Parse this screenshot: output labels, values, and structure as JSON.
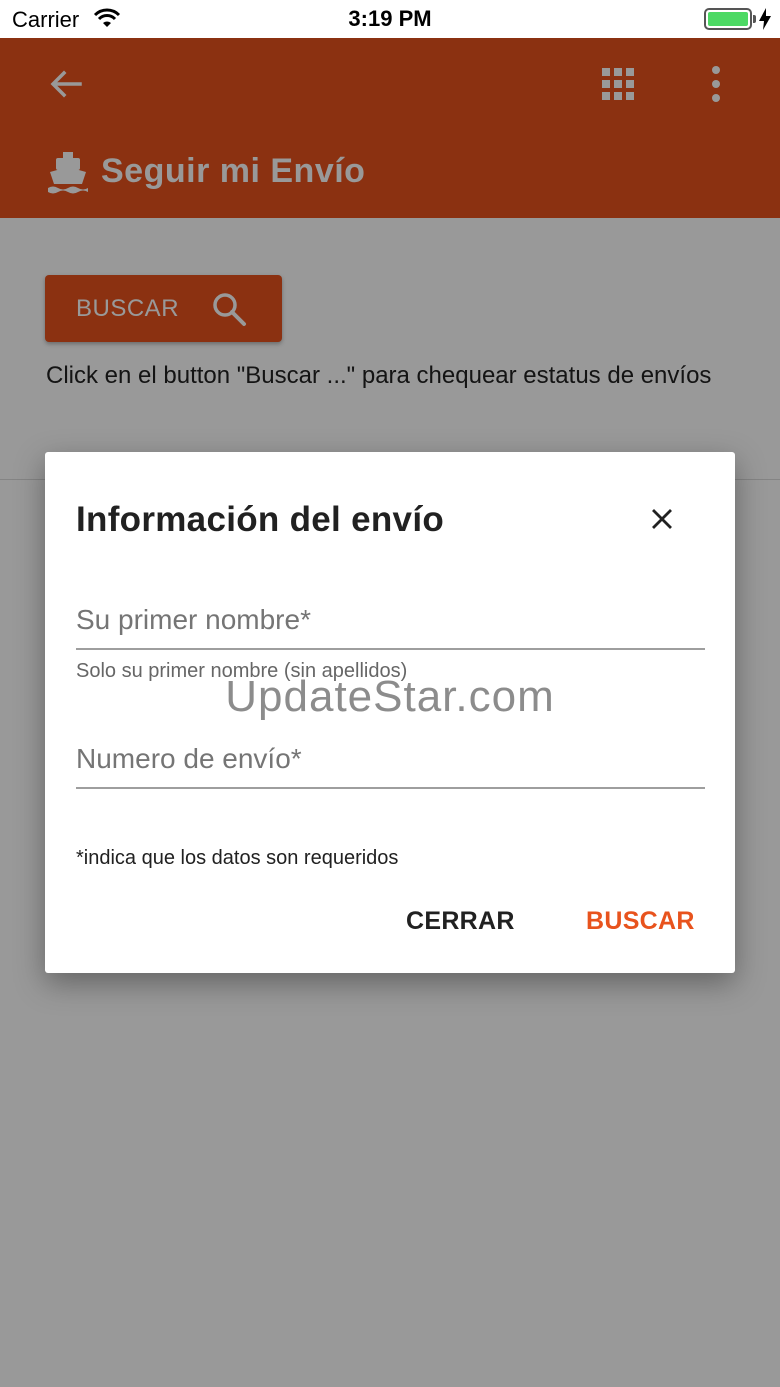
{
  "status_bar": {
    "carrier": "Carrier",
    "time": "3:19 PM",
    "battery_level": 1.0
  },
  "app_bar": {
    "title": "Seguir mi Envío",
    "icons": [
      "arrow-back-icon",
      "apps-grid-icon",
      "more-vert-icon",
      "ship-icon"
    ],
    "color": "#e8531d"
  },
  "main": {
    "search_button_label": "BUSCAR",
    "help_text": "Click en el button \"Buscar ...\" para chequear estatus de envíos"
  },
  "dialog": {
    "title": "Información del envío",
    "first_name": {
      "value": "",
      "placeholder": "Su primer nombre*",
      "helper": "Solo su primer nombre (sin apellidos)"
    },
    "shipment_number": {
      "value": "",
      "placeholder": "Numero de envío*"
    },
    "required_note": "*indica que los datos son requeridos",
    "close_label": "CERRAR",
    "search_label": "BUSCAR",
    "accent_color": "#e8531d"
  },
  "watermark": "UpdateStar.com"
}
